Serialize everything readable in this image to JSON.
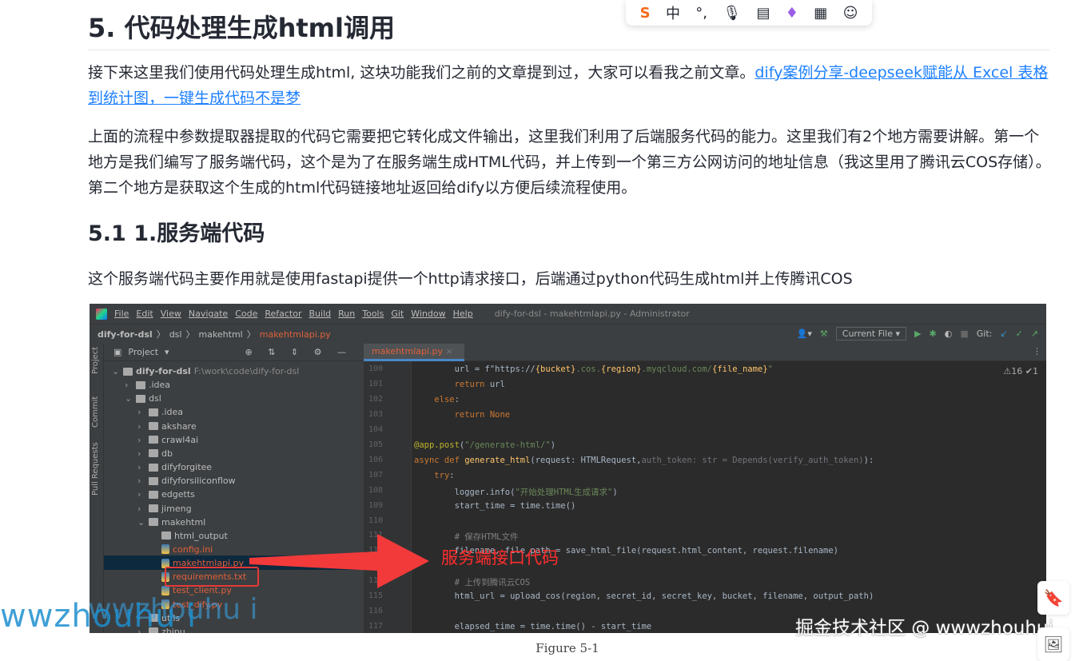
{
  "article": {
    "h2": "5. 代码处理生成html调用",
    "p1_text": "接下来这里我们使用代码处理生成html, 这块功能我们之前的文章提到过，大家可以看我之前文章。",
    "p1_link": "dify案例分享-deepseek赋能从 Excel 表格到统计图，一键生成代码不是梦",
    "p2": "上面的流程中参数提取器提取的代码它需要把它转化成文件输出，这里我们利用了后端服务代码的能力。这里我们有2个地方需要讲解。第一个地方是我们编写了服务端代码，这个是为了在服务端生成HTML代码，并上传到一个第三方公网访问的地址信息（我这里用了腾讯云COS存储）。第二个地方是获取这个生成的html代码链接地址返回给dify以方便后续流程使用。",
    "h3": "5.1 1.服务端代码",
    "p3": "这个服务端代码主要作用就是使用fastapi提供一个http请求接口，后端通过python代码生成html并上传腾讯COS",
    "caption": "Figure 5-1"
  },
  "ide": {
    "menu": [
      "File",
      "Edit",
      "View",
      "Navigate",
      "Code",
      "Refactor",
      "Build",
      "Run",
      "Tools",
      "Git",
      "Window",
      "Help"
    ],
    "window_title": "dify-for-dsl - makehtmlapi.py - Administrator",
    "breadcrumb": [
      "dify-for-dsl",
      "dsl",
      "makehtml",
      "makehtmlapi.py"
    ],
    "run_config": "Current File",
    "git_label": "Git:",
    "side_tabs": [
      "Project",
      "Commit",
      "Pull Requests"
    ],
    "project_label": "Project",
    "tab": "makehtmlapi.py",
    "inspections": "⚠16 ✔1",
    "tree": [
      {
        "label": "dify-for-dsl",
        "path": "F:\\work\\code\\dify-for-dsl",
        "depth": 0,
        "type": "root"
      },
      {
        "label": ".idea",
        "depth": 1,
        "type": "folder"
      },
      {
        "label": "dsl",
        "depth": 1,
        "type": "folder"
      },
      {
        "label": ".idea",
        "depth": 2,
        "type": "folder"
      },
      {
        "label": "akshare",
        "depth": 2,
        "type": "folder"
      },
      {
        "label": "crawl4ai",
        "depth": 2,
        "type": "folder"
      },
      {
        "label": "db",
        "depth": 2,
        "type": "folder"
      },
      {
        "label": "difyforgitee",
        "depth": 2,
        "type": "folder"
      },
      {
        "label": "difyforsiliconflow",
        "depth": 2,
        "type": "folder"
      },
      {
        "label": "edgetts",
        "depth": 2,
        "type": "folder"
      },
      {
        "label": "jimeng",
        "depth": 2,
        "type": "folder"
      },
      {
        "label": "makehtml",
        "depth": 2,
        "type": "folder"
      },
      {
        "label": "html_output",
        "depth": 3,
        "type": "folder"
      },
      {
        "label": "config.ini",
        "depth": 3,
        "type": "file",
        "red": true
      },
      {
        "label": "makehtmlapi.py",
        "depth": 3,
        "type": "file",
        "red": true,
        "selected": true
      },
      {
        "label": "requirements.txt",
        "depth": 3,
        "type": "file",
        "red": true
      },
      {
        "label": "test_client.py",
        "depth": 3,
        "type": "file",
        "red": true
      },
      {
        "label": "test_dify.py",
        "depth": 3,
        "type": "file",
        "red": true
      },
      {
        "label": "utils",
        "depth": 2,
        "type": "folder"
      },
      {
        "label": "zhipu",
        "depth": 2,
        "type": "folder"
      }
    ],
    "code": [
      {
        "n": "100",
        "t": [
          [
            "        url = ",
            ""
          ],
          [
            "f\"https://",
            ""
          ],
          [
            "{bucket}",
            "fn"
          ],
          [
            ".cos.",
            "st"
          ],
          [
            "{region}",
            "fn"
          ],
          [
            ".myqcloud.com/",
            "st"
          ],
          [
            "{file_name}",
            "fn"
          ],
          [
            "\"",
            "st"
          ]
        ]
      },
      {
        "n": "101",
        "t": [
          [
            "        ",
            ""
          ],
          [
            "return ",
            "kw"
          ],
          [
            "url",
            ""
          ]
        ]
      },
      {
        "n": "102",
        "t": [
          [
            "    ",
            ""
          ],
          [
            "else",
            "kw"
          ],
          [
            ":",
            ""
          ]
        ]
      },
      {
        "n": "103",
        "t": [
          [
            "        ",
            ""
          ],
          [
            "return None",
            "kw"
          ]
        ]
      },
      {
        "n": "104",
        "t": []
      },
      {
        "n": "105",
        "t": [
          [
            "@app.post",
            "dec"
          ],
          [
            "(",
            ""
          ],
          [
            "\"/generate-html/\"",
            "st"
          ],
          [
            ")",
            ""
          ]
        ]
      },
      {
        "n": "106",
        "t": [
          [
            "async def ",
            "kw"
          ],
          [
            "generate_html",
            "fn"
          ],
          [
            "(request: HTMLRequest,",
            ""
          ],
          [
            "auth_token: str = Depends(verify_auth_token)",
            "dim"
          ],
          [
            "):",
            ""
          ]
        ]
      },
      {
        "n": "107",
        "t": [
          [
            "    ",
            ""
          ],
          [
            "try",
            "kw"
          ],
          [
            ":",
            ""
          ]
        ]
      },
      {
        "n": "108",
        "t": [
          [
            "        logger.info(",
            ""
          ],
          [
            "\"开始处理HTML生成请求\"",
            "st"
          ],
          [
            ")",
            ""
          ]
        ]
      },
      {
        "n": "109",
        "t": [
          [
            "        start_time = time.time()",
            ""
          ]
        ]
      },
      {
        "n": "110",
        "t": []
      },
      {
        "n": "111",
        "t": [
          [
            "        # 保存HTML文件",
            "cm"
          ]
        ]
      },
      {
        "n": "112",
        "t": [
          [
            "        filename, file_path = save_html_file(request.html_content, request.filename)",
            ""
          ]
        ]
      },
      {
        "n": "113",
        "t": []
      },
      {
        "n": "114",
        "t": [
          [
            "        # 上传到腾讯云COS",
            "cm"
          ]
        ]
      },
      {
        "n": "115",
        "t": [
          [
            "        html_url = upload_cos(region, secret_id, secret_key, bucket, filename, output_path)",
            ""
          ]
        ]
      },
      {
        "n": "116",
        "t": []
      },
      {
        "n": "117",
        "t": [
          [
            "        elapsed_time = time.time() - start_time",
            ""
          ]
        ]
      }
    ],
    "annotation": "服务端接口代码"
  },
  "watermarks": {
    "left": "wwzhouhu i",
    "left2": "wwzhouhu i",
    "juejin": "掘金技术社区 @ wwwzhouhui"
  },
  "ime_toolbar": {
    "items": [
      "S",
      "中",
      "°,",
      "mic-icon",
      "keyboard-icon",
      "skin-icon",
      "grid-icon",
      "mascot-icon"
    ]
  },
  "colors": {
    "link": "#1e80ff",
    "ide_bg": "#2b2b2b",
    "annotation": "#ff2d2d"
  }
}
